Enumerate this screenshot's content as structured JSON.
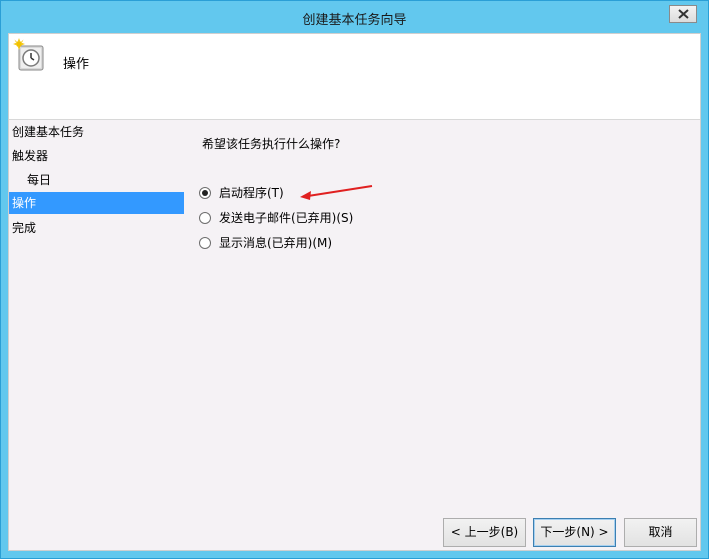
{
  "window": {
    "title": "创建基本任务向导"
  },
  "header": {
    "title": "操作",
    "icon": "task-scheduler-clock-icon"
  },
  "nav": {
    "items": [
      {
        "label": "创建基本任务",
        "indent": false,
        "selected": false
      },
      {
        "label": "触发器",
        "indent": false,
        "selected": false
      },
      {
        "label": "每日",
        "indent": true,
        "selected": false
      },
      {
        "label": "操作",
        "indent": false,
        "selected": true
      },
      {
        "label": "完成",
        "indent": false,
        "selected": false
      }
    ]
  },
  "main": {
    "prompt": "希望该任务执行什么操作?",
    "options": [
      {
        "label": "启动程序(T)",
        "checked": true
      },
      {
        "label": "发送电子邮件(已弃用)(S)",
        "checked": false
      },
      {
        "label": "显示消息(已弃用)(M)",
        "checked": false
      }
    ]
  },
  "footer": {
    "back_label": "< 上一步(B)",
    "next_label": "下一步(N) >",
    "cancel_label": "取消"
  },
  "colors": {
    "titlebar": "#62c8ee",
    "selection": "#3399ff",
    "annotation_arrow": "#e02020"
  }
}
